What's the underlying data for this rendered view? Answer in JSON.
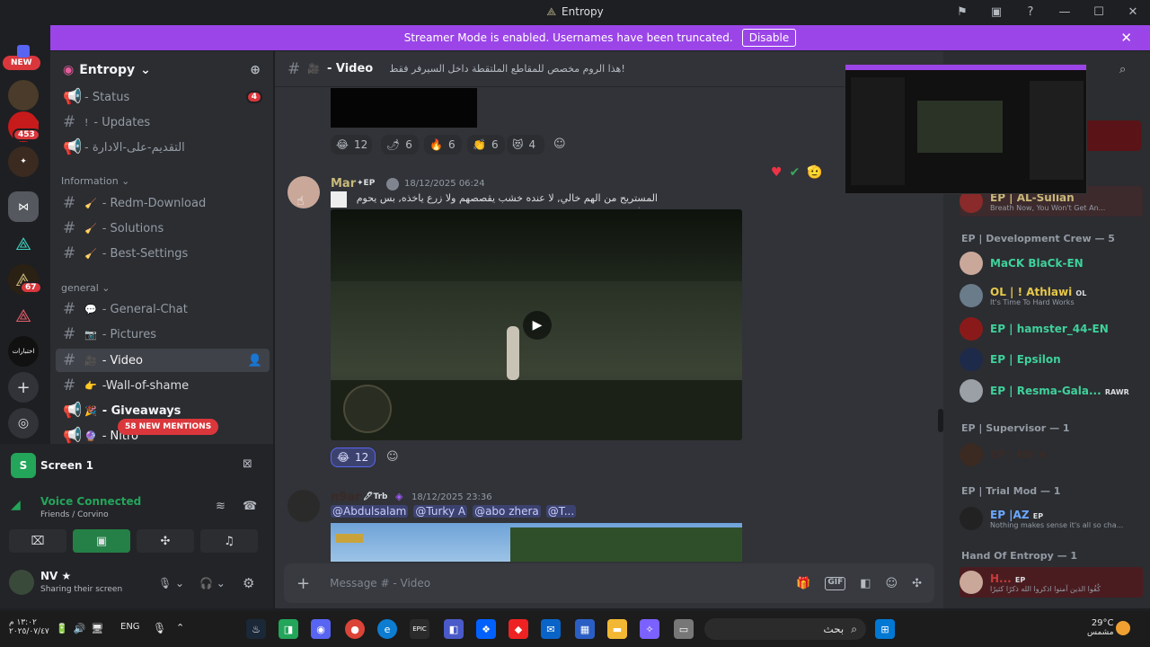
{
  "window": {
    "title": "Entropy"
  },
  "streamer": {
    "text": "Streamer Mode is enabled. Usernames have been truncated.",
    "disable": "Disable"
  },
  "guilds": {
    "new": "NEW",
    "badges": [
      "1",
      "453",
      "67"
    ],
    "text_label": "اختبارات"
  },
  "server": {
    "name": "Entropy"
  },
  "channels": [
    {
      "name": "- Status",
      "badge": "4"
    },
    {
      "name": "- Updates"
    },
    {
      "name": "- التقديم-على-الادارة"
    },
    {
      "category": "Information"
    },
    {
      "name": "- Redm-Download"
    },
    {
      "name": "- Solutions"
    },
    {
      "name": "- Best-Settings"
    },
    {
      "category": "general"
    },
    {
      "name": "- General-Chat"
    },
    {
      "name": "- Pictures"
    },
    {
      "name": "- Video"
    },
    {
      "name": "-Wall-of-shame"
    },
    {
      "name": "- Giveaways"
    },
    {
      "name": "- Nitro"
    }
  ],
  "mentions": "58 NEW MENTIONS",
  "voice": {
    "screen": "Screen 1",
    "connected": "Voice Connected",
    "sub": "Friends  /  Corvino"
  },
  "user": {
    "name": "NV ★",
    "status": "Sharing their screen"
  },
  "header": {
    "channel": "- Video",
    "topic": "هذا الروم مخصص للمقاطع الملتقطة داخل السيرفر فقط!"
  },
  "reactions_top": [
    {
      "emoji": "😂",
      "count": "12"
    },
    {
      "emoji": "🌶",
      "count": "6"
    },
    {
      "emoji": "🔥",
      "count": "6"
    },
    {
      "emoji": "👏",
      "count": "6"
    },
    {
      "emoji": "😻",
      "count": "4"
    }
  ],
  "msg1": {
    "author": "Mar",
    "tag": "EP",
    "time": "18/12/2025 06:24",
    "text": "المستريح من الهم خالي, لا عنده خشب يقصصهم ولا زرع ياخذه, بس يحوم ويصفر",
    "reaction": {
      "emoji": "😂",
      "count": "12"
    }
  },
  "msg2": {
    "author": "n9ar",
    "tag": "Trb",
    "time": "18/12/2025 23:36",
    "mentions": [
      "@Abdulsalam",
      "@Turky A",
      "@abo zhera",
      "@T..."
    ]
  },
  "compose": {
    "placeholder": "Message # - Video"
  },
  "members": {
    "top": {
      "name": "EP | AL-Sulian",
      "tag": "EP",
      "status": "Breath Now, You Won't Get An..."
    },
    "dev_cat": "EP | Development Crew — 5",
    "dev": [
      {
        "name": "MaCK BlaCk-EN"
      },
      {
        "name": "OL | ! Athlawi",
        "tag": "OL",
        "status": "It's Time To Hard Works"
      },
      {
        "name": "EP | hamster_44-EN"
      },
      {
        "name": "EP | Epsilon"
      },
      {
        "name": "EP | Resma-Gala...",
        "tag": "RAWR"
      }
    ],
    "sup_cat": "EP | Supervisor — 1",
    "sup": [
      {
        "name": "EP | NV ★"
      }
    ],
    "trial_cat": "EP | Trial Mod — 1",
    "trial": [
      {
        "name": "EP |AZ",
        "tag": "EP",
        "status": "Nothing makes sense it's all so cha..."
      }
    ],
    "hand_cat": "Hand Of Entropy — 1",
    "hand": [
      {
        "name": "H...",
        "tag": "EP",
        "status": "كُفُوا الذين آمنوا اذكروا الله ذكرًا كثيرًا"
      }
    ]
  },
  "taskbar": {
    "time": "١٣:٠٢ م",
    "date": "٢٠٢٥/٠٧/٤٧",
    "lang": "ENG",
    "search": "بحث",
    "weather": "29°C",
    "weather_sub": "مشمس"
  }
}
